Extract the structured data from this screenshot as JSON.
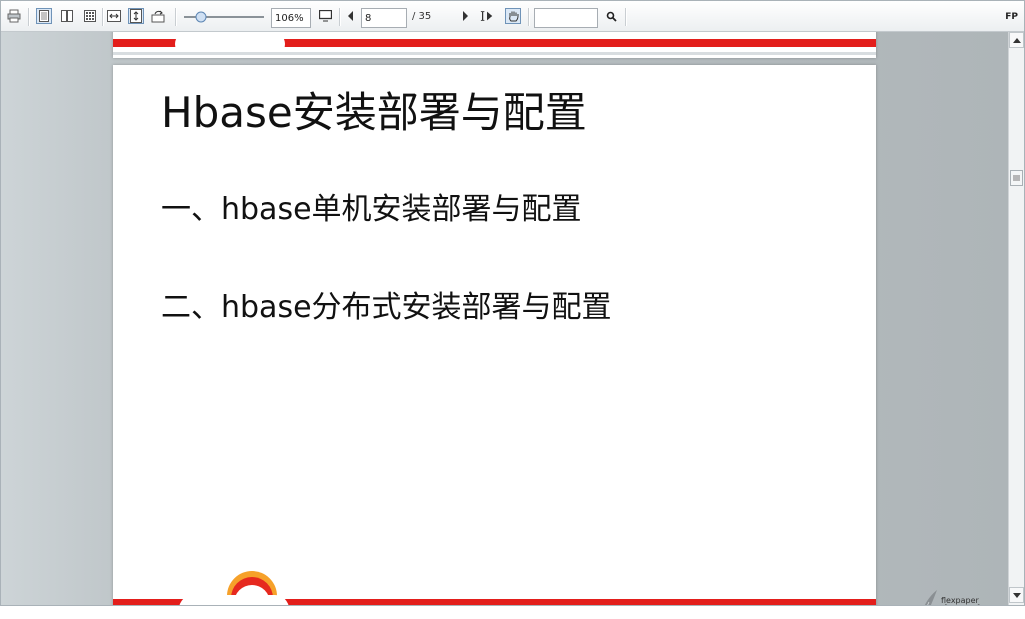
{
  "toolbar": {
    "zoom_value": "106%",
    "page_current": "8",
    "page_total_label": "/ 35",
    "search_value": "",
    "brand": "FP"
  },
  "document": {
    "title": "Hbase安装部署与配置",
    "items": [
      "一、hbase单机安装部署与配置",
      "二、hbase分布式安装部署与配置"
    ],
    "accent_color": "#e31e1b"
  },
  "logo": {
    "small": "flexpaper",
    "large": "classic"
  },
  "icons": [
    "print-icon",
    "single-page-icon",
    "two-page-icon",
    "thumbnails-icon",
    "fit-width-icon",
    "fit-height-icon",
    "rotate-icon",
    "zoom-slider",
    "fullscreen-icon",
    "prev-page-icon",
    "next-page-icon",
    "text-select-icon",
    "hand-tool-icon",
    "search-icon",
    "scroll-up-icon",
    "scroll-down-icon"
  ]
}
